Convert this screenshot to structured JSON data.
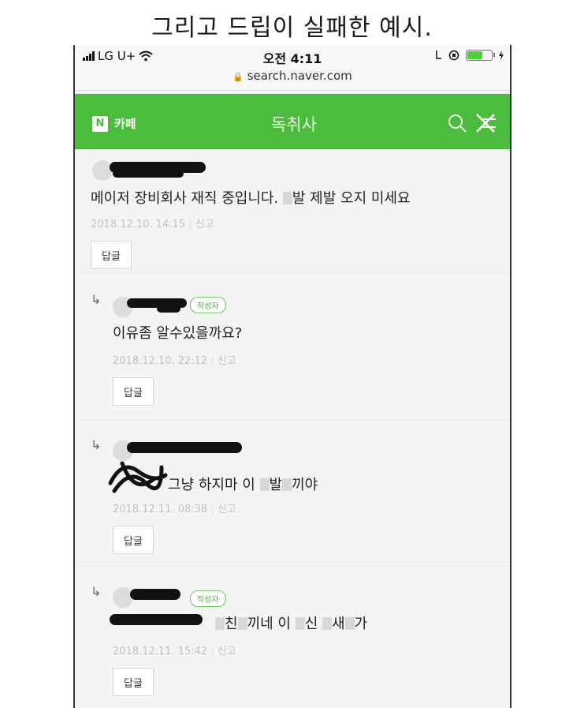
{
  "caption": "그리고 드립이 실패한 예시.",
  "statusbar": {
    "carrier": "LG U+",
    "time": "오전 4:11",
    "url": "search.naver.com",
    "battery_level": 0.65,
    "battery_color": "#4cd137"
  },
  "navbar": {
    "logo": "N",
    "section": "카페",
    "title": "독취사",
    "color": "#4cbc3e",
    "icons": [
      "search-icon",
      "close-icon"
    ]
  },
  "comments": [
    {
      "is_reply": false,
      "author_badge": "",
      "text_parts": [
        "메이저 장비회사 재직 중입니다. ",
        "",
        "발 제발 오지 미세요"
      ],
      "date": "2018.12.10. 14:15",
      "report": "신고",
      "reply_label": "답글"
    },
    {
      "is_reply": true,
      "author_badge": "작성자",
      "text_parts": [
        "이유좀 알수있을까요?"
      ],
      "date": "2018.12.10. 22:12",
      "report": "신고",
      "reply_label": "답글"
    },
    {
      "is_reply": true,
      "author_badge": "",
      "text_parts": [
        "그냥 하지마 이 ",
        "",
        "발",
        "",
        "끼야"
      ],
      "date": "2018.12.11. 08:38",
      "report": "신고",
      "reply_label": "답글"
    },
    {
      "is_reply": true,
      "author_badge": "작성자",
      "text_parts": [
        "",
        "친",
        "",
        "끼네 이 ",
        "",
        "신 ",
        "",
        "새",
        "",
        "가"
      ],
      "date": "2018.12.11. 15:42",
      "report": "신고",
      "reply_label": "답글"
    }
  ]
}
